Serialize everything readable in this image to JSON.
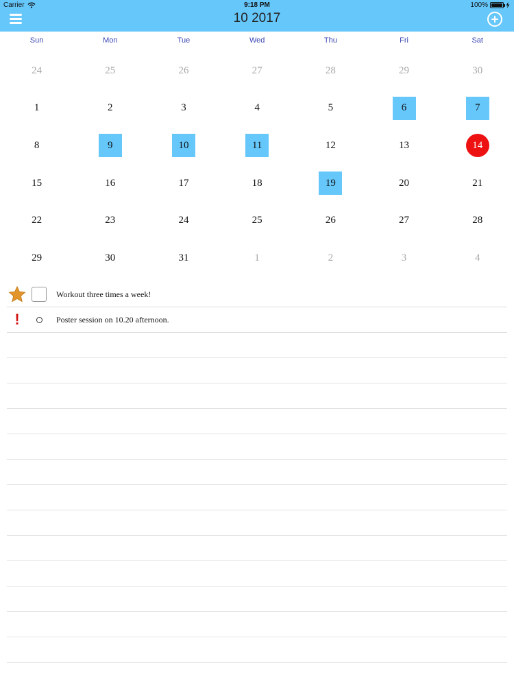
{
  "status_bar": {
    "carrier": "Carrier",
    "time": "9:18 PM",
    "battery": "100%"
  },
  "nav": {
    "title": "10 2017",
    "menu_icon": "hamburger-icon",
    "add_icon": "plus-circle-icon"
  },
  "calendar": {
    "weekdays": [
      "Sun",
      "Mon",
      "Tue",
      "Wed",
      "Thu",
      "Fri",
      "Sat"
    ],
    "weeks": [
      [
        {
          "day": "24",
          "muted": true
        },
        {
          "day": "25",
          "muted": true
        },
        {
          "day": "26",
          "muted": true
        },
        {
          "day": "27",
          "muted": true
        },
        {
          "day": "28",
          "muted": true
        },
        {
          "day": "29",
          "muted": true
        },
        {
          "day": "30",
          "muted": true
        }
      ],
      [
        {
          "day": "1"
        },
        {
          "day": "2"
        },
        {
          "day": "3"
        },
        {
          "day": "4"
        },
        {
          "day": "5"
        },
        {
          "day": "6",
          "event": true
        },
        {
          "day": "7",
          "event": true
        }
      ],
      [
        {
          "day": "8"
        },
        {
          "day": "9",
          "event": true
        },
        {
          "day": "10",
          "event": true
        },
        {
          "day": "11",
          "event": true
        },
        {
          "day": "12"
        },
        {
          "day": "13"
        },
        {
          "day": "14",
          "today": true
        }
      ],
      [
        {
          "day": "15"
        },
        {
          "day": "16"
        },
        {
          "day": "17"
        },
        {
          "day": "18"
        },
        {
          "day": "19",
          "event": true
        },
        {
          "day": "20"
        },
        {
          "day": "21"
        }
      ],
      [
        {
          "day": "22"
        },
        {
          "day": "23"
        },
        {
          "day": "24"
        },
        {
          "day": "25"
        },
        {
          "day": "26"
        },
        {
          "day": "27"
        },
        {
          "day": "28"
        }
      ],
      [
        {
          "day": "29"
        },
        {
          "day": "30"
        },
        {
          "day": "31"
        },
        {
          "day": "1",
          "muted": true
        },
        {
          "day": "2",
          "muted": true
        },
        {
          "day": "3",
          "muted": true
        },
        {
          "day": "4",
          "muted": true
        }
      ]
    ],
    "colors": {
      "event": "#66c7fb",
      "today": "#ee1111",
      "weekday_label": "#3b47b4"
    }
  },
  "tasks": [
    {
      "text": "Workout three times a week!",
      "lead_icon": "star-icon",
      "control": "checkbox"
    },
    {
      "text": "Poster session on 10.20 afternoon.",
      "lead_icon": "exclamation-icon",
      "control": "circle"
    }
  ],
  "empty_rows": 13,
  "accent_color": "#66c7fb"
}
